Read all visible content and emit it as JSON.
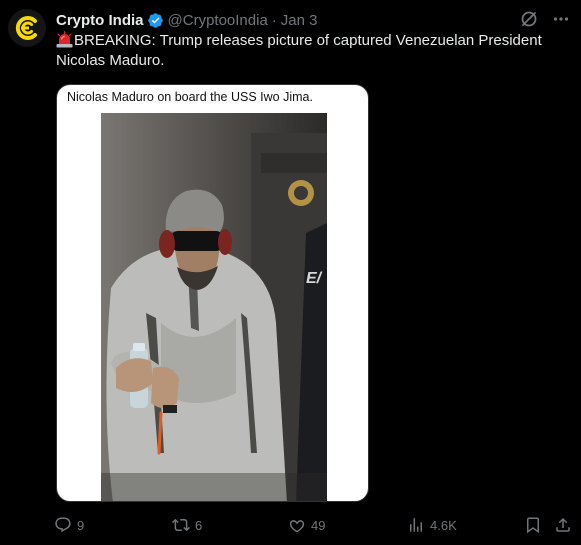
{
  "post": {
    "display_name": "Crypto India",
    "handle": "@CryptooIndia",
    "separator": "·",
    "date": "Jan 3",
    "avatar_icon": "crypto-india-logo-icon",
    "verified_icon": "verified-badge-icon",
    "text_prefix_icon": "siren-emoji-icon",
    "text": "BREAKING: Trump releases picture of captured Venezuelan President Nicolas Maduro.",
    "media": {
      "caption": "Nicolas Maduro on board the USS Iwo Jima."
    }
  },
  "top_icons": [
    "grok-icon",
    "more-options-icon"
  ],
  "actions": {
    "reply_count": "9",
    "repost_count": "6",
    "like_count": "49",
    "views_count": "4.6K",
    "bookmark_icon": "bookmark-icon",
    "share_icon": "share-icon"
  },
  "colors": {
    "background": "#000000",
    "text": "#e7e9ea",
    "muted": "#71767b",
    "verified": "#1d9bf0",
    "avatar_accent": "#f5d90a"
  }
}
